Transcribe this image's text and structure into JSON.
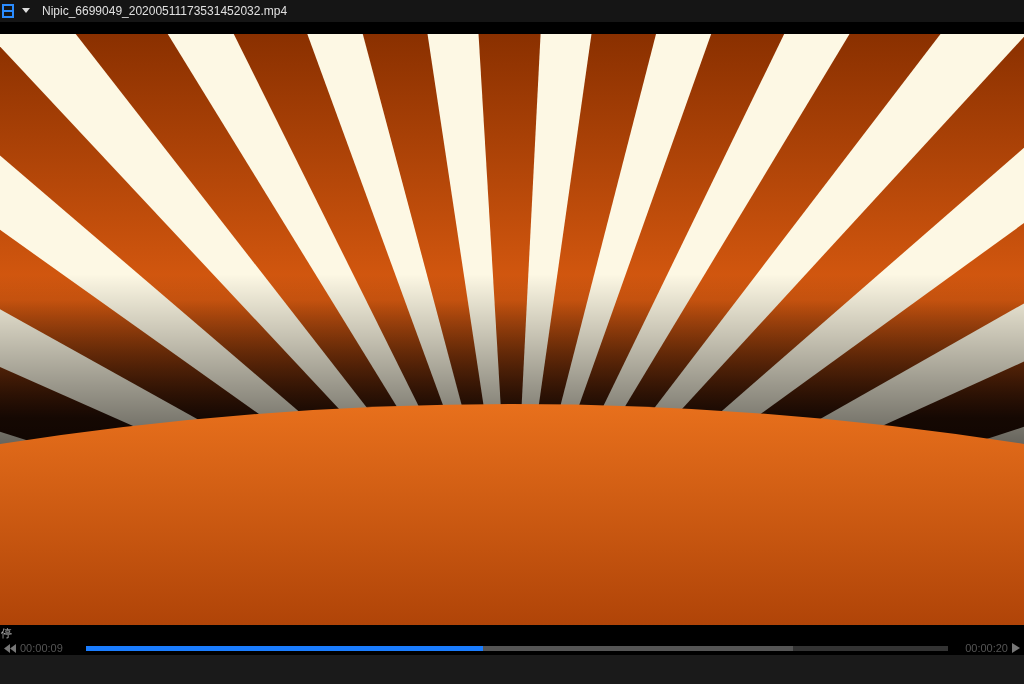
{
  "title_bar": {
    "title": "Nipic_6699049_20200511173531452032.mp4"
  },
  "status": {
    "text": "停"
  },
  "progress": {
    "elapsed": "00:00:09",
    "duration": "00:00:20",
    "level": 0.46,
    "buffer": {
      "level": 0.82
    }
  }
}
